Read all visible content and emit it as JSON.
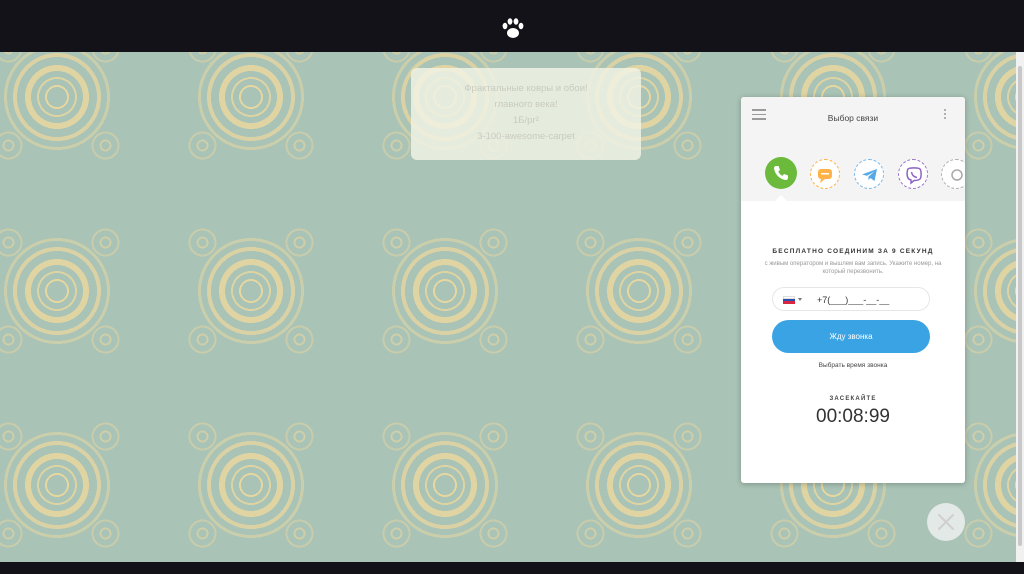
{
  "topbar": {
    "logo_icon": "paw-icon"
  },
  "notice": {
    "lines": [
      "Фрактальные ковры и обои!",
      "главного века!",
      "1Б/рг²",
      "3-100-awesome-carpet"
    ]
  },
  "widget": {
    "title": "Выбор связи",
    "channels": [
      "phone-icon",
      "sms-icon",
      "telegram-icon",
      "viber-icon",
      "more-channel-icon"
    ],
    "cta_title": "БЕСПЛАТНО СОЕДИНИМ ЗА 9 СЕКУНД",
    "cta_sub": "с живым оператором и вышлем вам запись. Укажите номер, на который перезвонить.",
    "country_flag": "ru-flag",
    "phone_value": "+7(___)___-__-__",
    "call_button": "Жду звонка",
    "time_link": "Выбрать время звонка",
    "timer_label": "ЗАСЕКАЙТЕ",
    "timer": "00:08:99"
  },
  "colors": {
    "accent": "#3aa3e3",
    "phone": "#6cba3c",
    "background": "#a9c3b6"
  }
}
